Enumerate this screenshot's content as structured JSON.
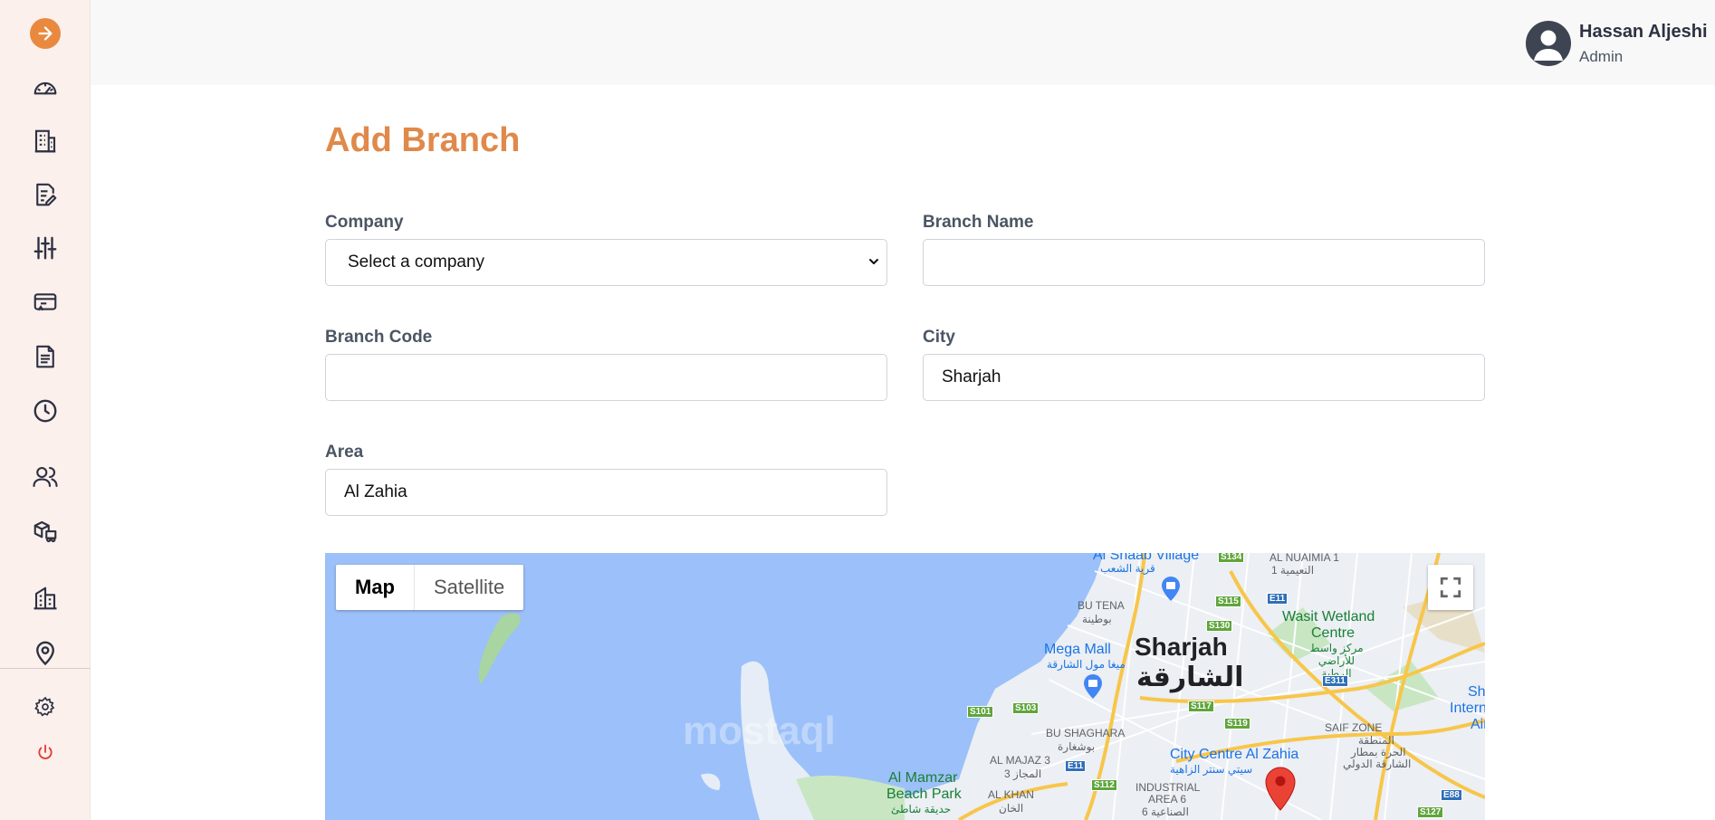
{
  "sidebar": {
    "toggle_icon": "arrow-right-icon",
    "accent_color": "#e9893f",
    "items": [
      {
        "icon": "dashboard-gauge-icon"
      },
      {
        "icon": "buildings-icon"
      },
      {
        "icon": "edit-document-icon"
      },
      {
        "icon": "sliders-icon"
      },
      {
        "icon": "ticket-card-icon"
      },
      {
        "icon": "document-icon"
      },
      {
        "icon": "clock-icon"
      },
      {
        "icon": "users-icon"
      },
      {
        "icon": "delivery-boxes-icon"
      },
      {
        "icon": "branch-building-icon"
      },
      {
        "icon": "location-pin-icon"
      },
      {
        "icon": "settings-gear-icon"
      },
      {
        "icon": "power-icon"
      }
    ]
  },
  "header": {
    "user_name": "Hassan Aljeshi",
    "user_role": "Admin",
    "menu_icon": "chevron-down-icon"
  },
  "page": {
    "title": "Add Branch",
    "title_color": "#e0894a"
  },
  "form": {
    "company": {
      "label": "Company",
      "value": "Select a company"
    },
    "branch_name": {
      "label": "Branch Name",
      "value": ""
    },
    "branch_code": {
      "label": "Branch Code",
      "value": ""
    },
    "city": {
      "label": "City",
      "value": "Sharjah"
    },
    "area": {
      "label": "Area",
      "value": "Al Zahia"
    }
  },
  "map": {
    "type_map": "Map",
    "type_satellite": "Satellite",
    "fullscreen_icon": "fullscreen-icon",
    "labels": {
      "sharjah_en": "Sharjah",
      "sharjah_ar": "الشارقة",
      "mega_mall": "Mega Mall",
      "mega_mall_ar": "ميغا مول الشارقة",
      "city_centre": "City Centre Al Zahia",
      "city_centre_ar": "سيتي سنتر الزاهية",
      "wasit": "Wasit Wetland",
      "wasit2": "Centre",
      "wasit_ar": "مركز واسط للأراضي الرطبة",
      "al_mamzar": "Al Mamzar",
      "beach_park": "Beach Park",
      "beach_park_ar": "حديقة شاطئ",
      "al_shaab": "Al Shaab Village",
      "al_shaab_ar": "قرية الشعب",
      "al_nuaimia": "AL NUAIMIA 1",
      "al_nuaimia_ar": "النعيمية 1",
      "bu_tena": "BU TENA",
      "bu_tena_ar": "بوطينة",
      "bu_shaghara": "BU SHAGHARA",
      "bu_shaghara_ar": "بوشغارة",
      "al_majaz": "AL MAJAZ 3",
      "al_majaz_ar": "المجاز 3",
      "al_khan": "AL KHAN",
      "al_khan_ar": "الخان",
      "industrial": "INDUSTRIAL",
      "area6": "AREA 6",
      "area6_ar": "الصناعية 6",
      "saif_zone": "SAIF ZONE",
      "saif_zone_ar1": "المنطقة",
      "saif_zone_ar2": "الحرة بمطار",
      "saif_zone_ar3": "الشارقة الدولي",
      "sh_inter": "Sh",
      "inter": "Intern",
      "air": "Air"
    },
    "roads": [
      "S134",
      "E11",
      "S115",
      "S130",
      "E311",
      "S101",
      "S103",
      "S117",
      "S119",
      "E11",
      "S112",
      "E88",
      "S127"
    ],
    "watermark": "mostaql"
  }
}
